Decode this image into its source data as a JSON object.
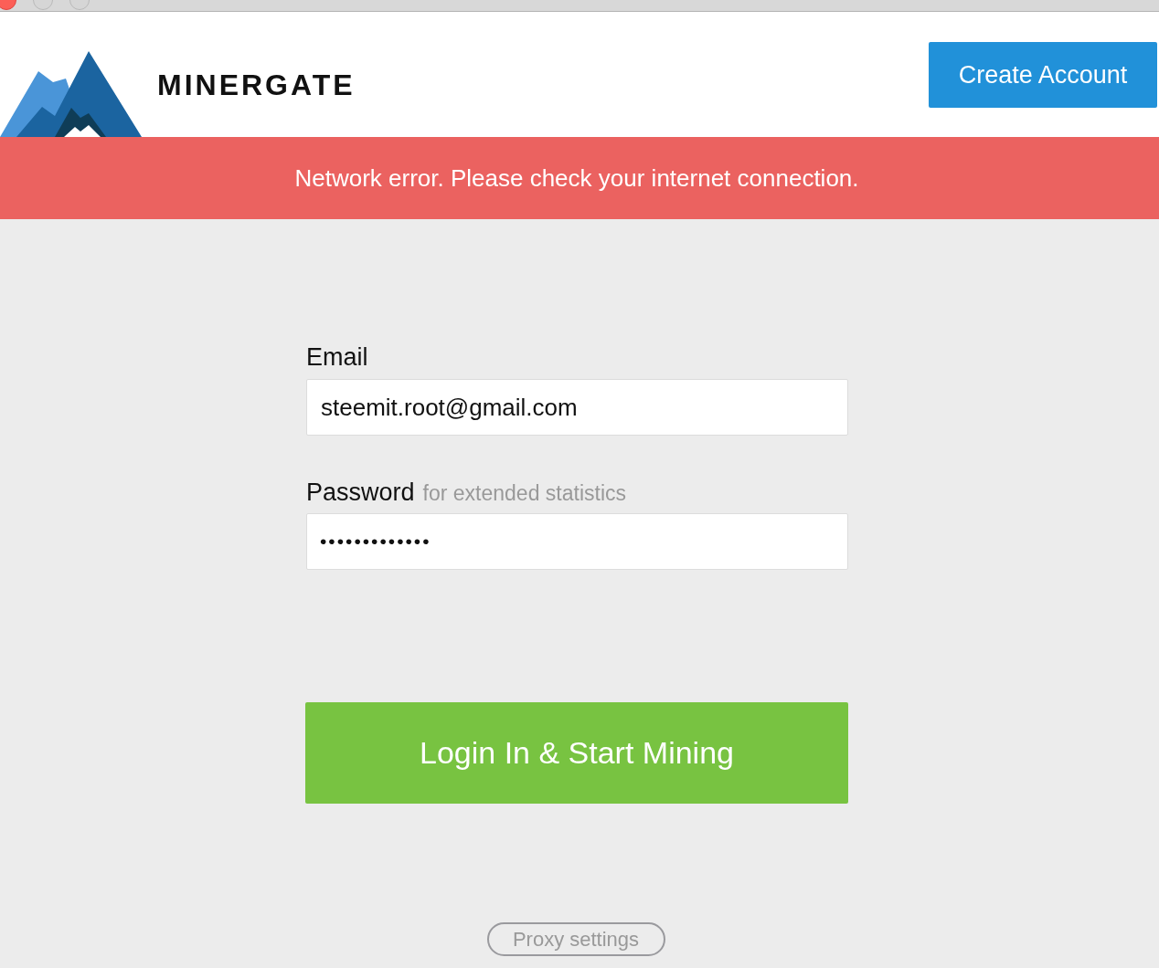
{
  "header": {
    "logo_text": "MINERGATE",
    "create_account_button": "Create Account"
  },
  "error_banner": {
    "message": "Network error. Please check your internet connection."
  },
  "login_form": {
    "email": {
      "label": "Email",
      "value": "steemit.root@gmail.com"
    },
    "password": {
      "label": "Password",
      "hint": "for extended statistics",
      "value": "•••••••••••••"
    },
    "submit_button": "Login In & Start Mining"
  },
  "proxy_settings_button": "Proxy settings"
}
